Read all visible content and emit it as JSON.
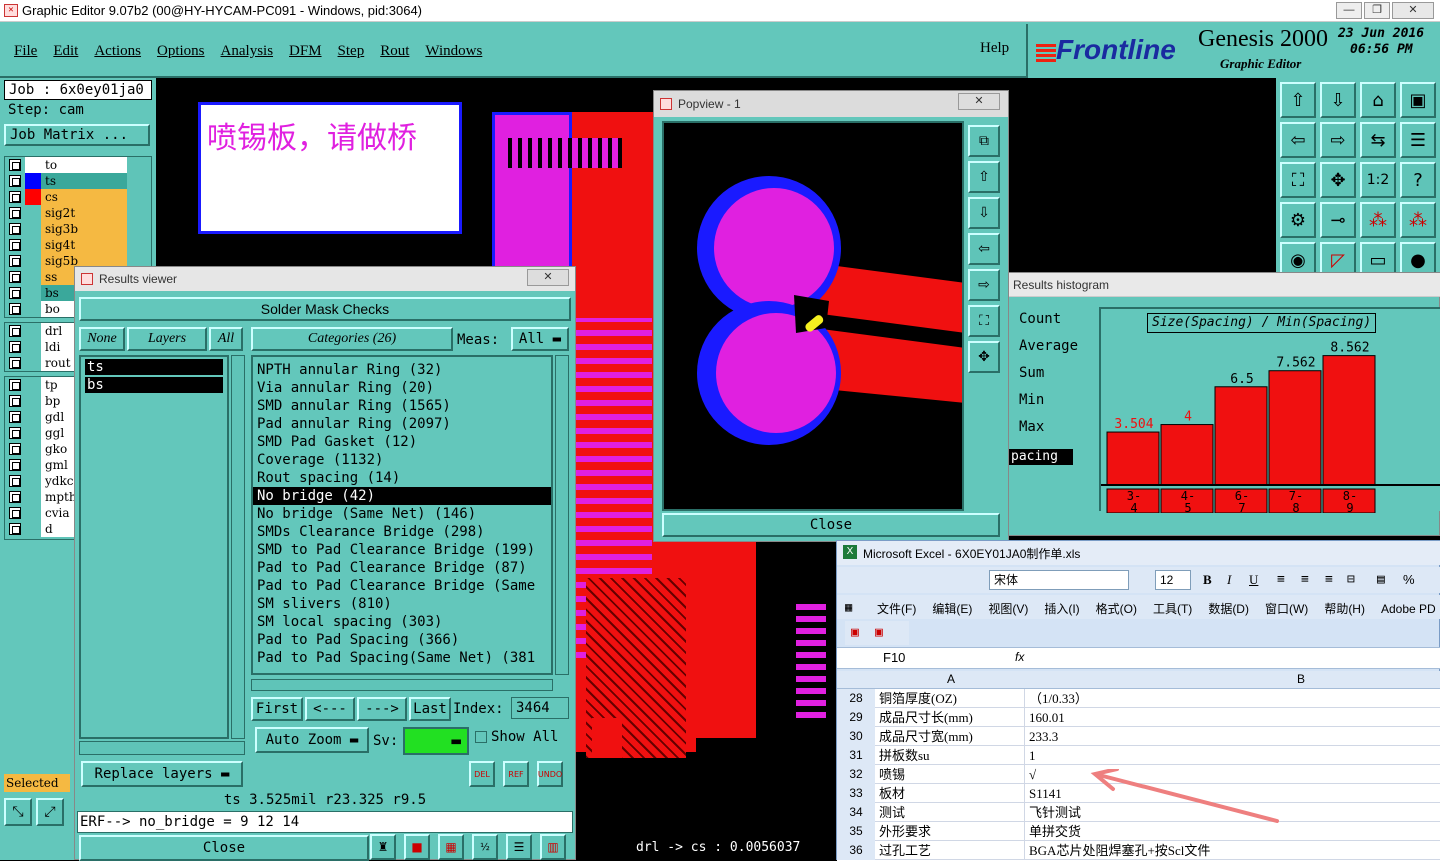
{
  "window": {
    "title": "Graphic Editor 9.07b2 (00@HY-HYCAM-PC091 - Windows, pid:3064)",
    "min": "—",
    "max": "❐",
    "close": "✕"
  },
  "menu": {
    "items": [
      "File",
      "Edit",
      "Actions",
      "Options",
      "Analysis",
      "DFM",
      "Step",
      "Rout",
      "Windows"
    ],
    "help": "Help"
  },
  "brand": {
    "logo": "Frontline",
    "product": "Genesis 2000",
    "subtitle": "Graphic Editor",
    "date": "23 Jun 2016",
    "time": "06:56 PM"
  },
  "job": {
    "job_label": "Job : 6x0ey01ja0",
    "step_label": "Step: cam",
    "matrix": "Job Matrix ..."
  },
  "layers": [
    {
      "name": "to",
      "color": "#ffffff",
      "sel": "#ffffff"
    },
    {
      "name": "ts",
      "color": "#0000ff",
      "sel": "#3aa89b"
    },
    {
      "name": "cs",
      "color": "#ff0000",
      "sel": "#f5b942"
    },
    {
      "name": "sig2t",
      "color": "#5fc4b8",
      "sel": "#f5b942"
    },
    {
      "name": "sig3b",
      "color": "#5fc4b8",
      "sel": "#f5b942"
    },
    {
      "name": "sig4t",
      "color": "#5fc4b8",
      "sel": "#f5b942"
    },
    {
      "name": "sig5b",
      "color": "#5fc4b8",
      "sel": "#f5b942"
    },
    {
      "name": "ss",
      "color": "#5fc4b8",
      "sel": "#f5b942"
    },
    {
      "name": "bs",
      "color": "#5fc4b8",
      "sel": "#3aa89b"
    },
    {
      "name": "bo",
      "color": "#5fc4b8",
      "sel": "#ffffff"
    }
  ],
  "layers2": [
    "drl",
    "ldi",
    "rout"
  ],
  "layers3": [
    "tp",
    "bp",
    "gdl",
    "ggl",
    "gko",
    "gml",
    "ydkc",
    "mpth",
    "cvia",
    "d"
  ],
  "selected_label": "Selected",
  "note": "喷锡板，请做桥",
  "results_viewer": {
    "title": "Results viewer",
    "heading": "Solder Mask Checks",
    "none": "None",
    "layers": "Layers",
    "all": "All",
    "categories_label": "Categories (26)",
    "meas_label": "Meas:",
    "meas_value": "All",
    "layer_list": [
      "ts",
      "bs"
    ],
    "categories": [
      "NPTH annular Ring (32)",
      "Via annular Ring (20)",
      "SMD annular Ring (1565)",
      "Pad annular Ring (2097)",
      "SMD Pad Gasket (12)",
      "Coverage (1132)",
      "Rout spacing (14)",
      "No bridge (42)",
      "No bridge (Same Net) (146)",
      "SMDs Clearance Bridge (298)",
      "SMD to Pad Clearance Bridge (199)",
      "Pad to Pad Clearance Bridge (87)",
      "Pad to Pad Clearance Bridge (Same",
      "SM slivers (810)",
      "SM local spacing (303)",
      "Pad to Pad Spacing (366)",
      "Pad to Pad Spacing(Same Net) (381"
    ],
    "selected_index": 7,
    "first": "First",
    "prev": "<---",
    "next": "--->",
    "last": "Last",
    "index_label": "Index:",
    "index_value": "3464",
    "auto_zoom": "Auto Zoom",
    "sv": "Sv:",
    "show_all": "Show All",
    "replace_layers": "Replace layers",
    "del": "DEL",
    "ref": "REF",
    "undo": "UNDO",
    "status": "ts 3.525mil  r23.325  r9.5",
    "erf": "ERF--> no_bridge = 9 12 14",
    "close": "Close"
  },
  "popview": {
    "title": "Popview - 1",
    "close": "Close"
  },
  "histogram": {
    "title": "Results histogram",
    "options": [
      "Count",
      "Average",
      "Sum",
      "Min",
      "Max"
    ],
    "selected": "pacing",
    "heading": "Size(Spacing) / Min(Spacing)"
  },
  "chart_data": {
    "type": "bar",
    "categories": [
      "3-4",
      "4-5",
      "6-7",
      "7-8",
      "8-9"
    ],
    "values": [
      3.504,
      4,
      6.5,
      7.562,
      8.562
    ],
    "value_labels": [
      "3.504",
      "4",
      "6.5",
      "7.562",
      "8.562"
    ],
    "title": "Size(Spacing) / Min(Spacing)",
    "ylim": [
      0,
      9
    ]
  },
  "statusbar": {
    "text": "drl -> cs : 0.0056037"
  },
  "excel": {
    "title": "Microsoft Excel - 6X0EY01JA0制作单.xls",
    "font": "宋体",
    "size": "12",
    "menus": [
      "文件(F)",
      "编辑(E)",
      "视图(V)",
      "插入(I)",
      "格式(O)",
      "工具(T)",
      "数据(D)",
      "窗口(W)",
      "帮助(H)",
      "Adobe PD"
    ],
    "cell_ref": "F10",
    "fx": "fx",
    "col_a": "A",
    "col_b": "B",
    "rows": [
      {
        "n": "28",
        "a": "铜箔厚度(OZ)",
        "b": "（1/0.33）"
      },
      {
        "n": "29",
        "a": "成品尺寸长(mm)",
        "b": "160.01"
      },
      {
        "n": "30",
        "a": "成品尺寸宽(mm)",
        "b": "233.3"
      },
      {
        "n": "31",
        "a": "拼板数su",
        "b": "1"
      },
      {
        "n": "32",
        "a": "喷锡",
        "b": "√"
      },
      {
        "n": "33",
        "a": "板材",
        "b": "S1141"
      },
      {
        "n": "34",
        "a": "测试",
        "b": "飞针测试"
      },
      {
        "n": "35",
        "a": "外形要求",
        "b": "单拼交货"
      },
      {
        "n": "36",
        "a": "过孔工艺",
        "b": "BGA芯片处阻焊塞孔+按Scl文件"
      }
    ]
  }
}
